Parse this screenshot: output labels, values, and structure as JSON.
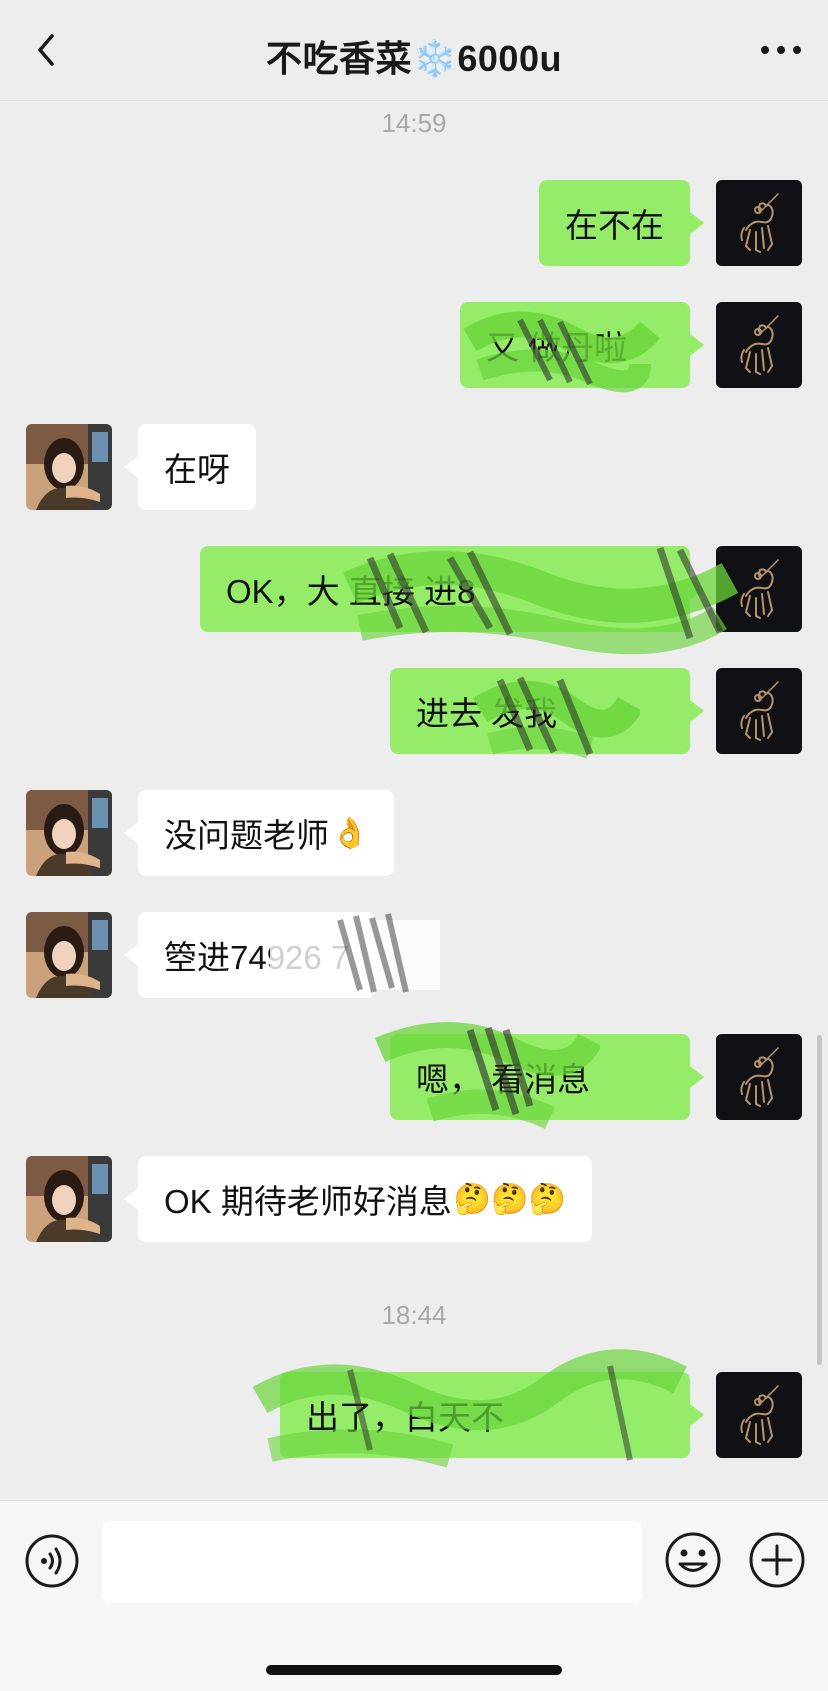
{
  "header": {
    "back_icon": "chevron-left-icon",
    "title_text": "不吃香菜",
    "title_emoji": "❄️",
    "title_suffix": "6000u",
    "more_icon": "ellipsis-icon"
  },
  "timestamps": [
    "14:59",
    "18:44"
  ],
  "messages": [
    {
      "from": "me",
      "text": "在不在"
    },
    {
      "from": "me",
      "text": "又   做丹啦"
    },
    {
      "from": "other",
      "text": "在呀"
    },
    {
      "from": "me",
      "text": "OK，大            直接   进8"
    },
    {
      "from": "me",
      "text": "进去        发我"
    },
    {
      "from": "other",
      "text": "没问题老师",
      "emoji": "👌"
    },
    {
      "from": "other",
      "text": "箜进74926  7"
    },
    {
      "from": "me",
      "text": "嗯，    看消息"
    },
    {
      "from": "other",
      "text": "OK 期待老师好消息",
      "emoji": "🤔🤔🤔"
    },
    {
      "from": "me",
      "text": "    出了，白天不"
    }
  ],
  "input_bar": {
    "voice_icon": "voice-icon",
    "input_value": "",
    "emoji_icon": "smiley-icon",
    "plus_icon": "plus-icon"
  },
  "colors": {
    "background": "#ededed",
    "my_bubble": "#95ec69",
    "other_bubble": "#ffffff",
    "scribble": "#78e03c"
  }
}
